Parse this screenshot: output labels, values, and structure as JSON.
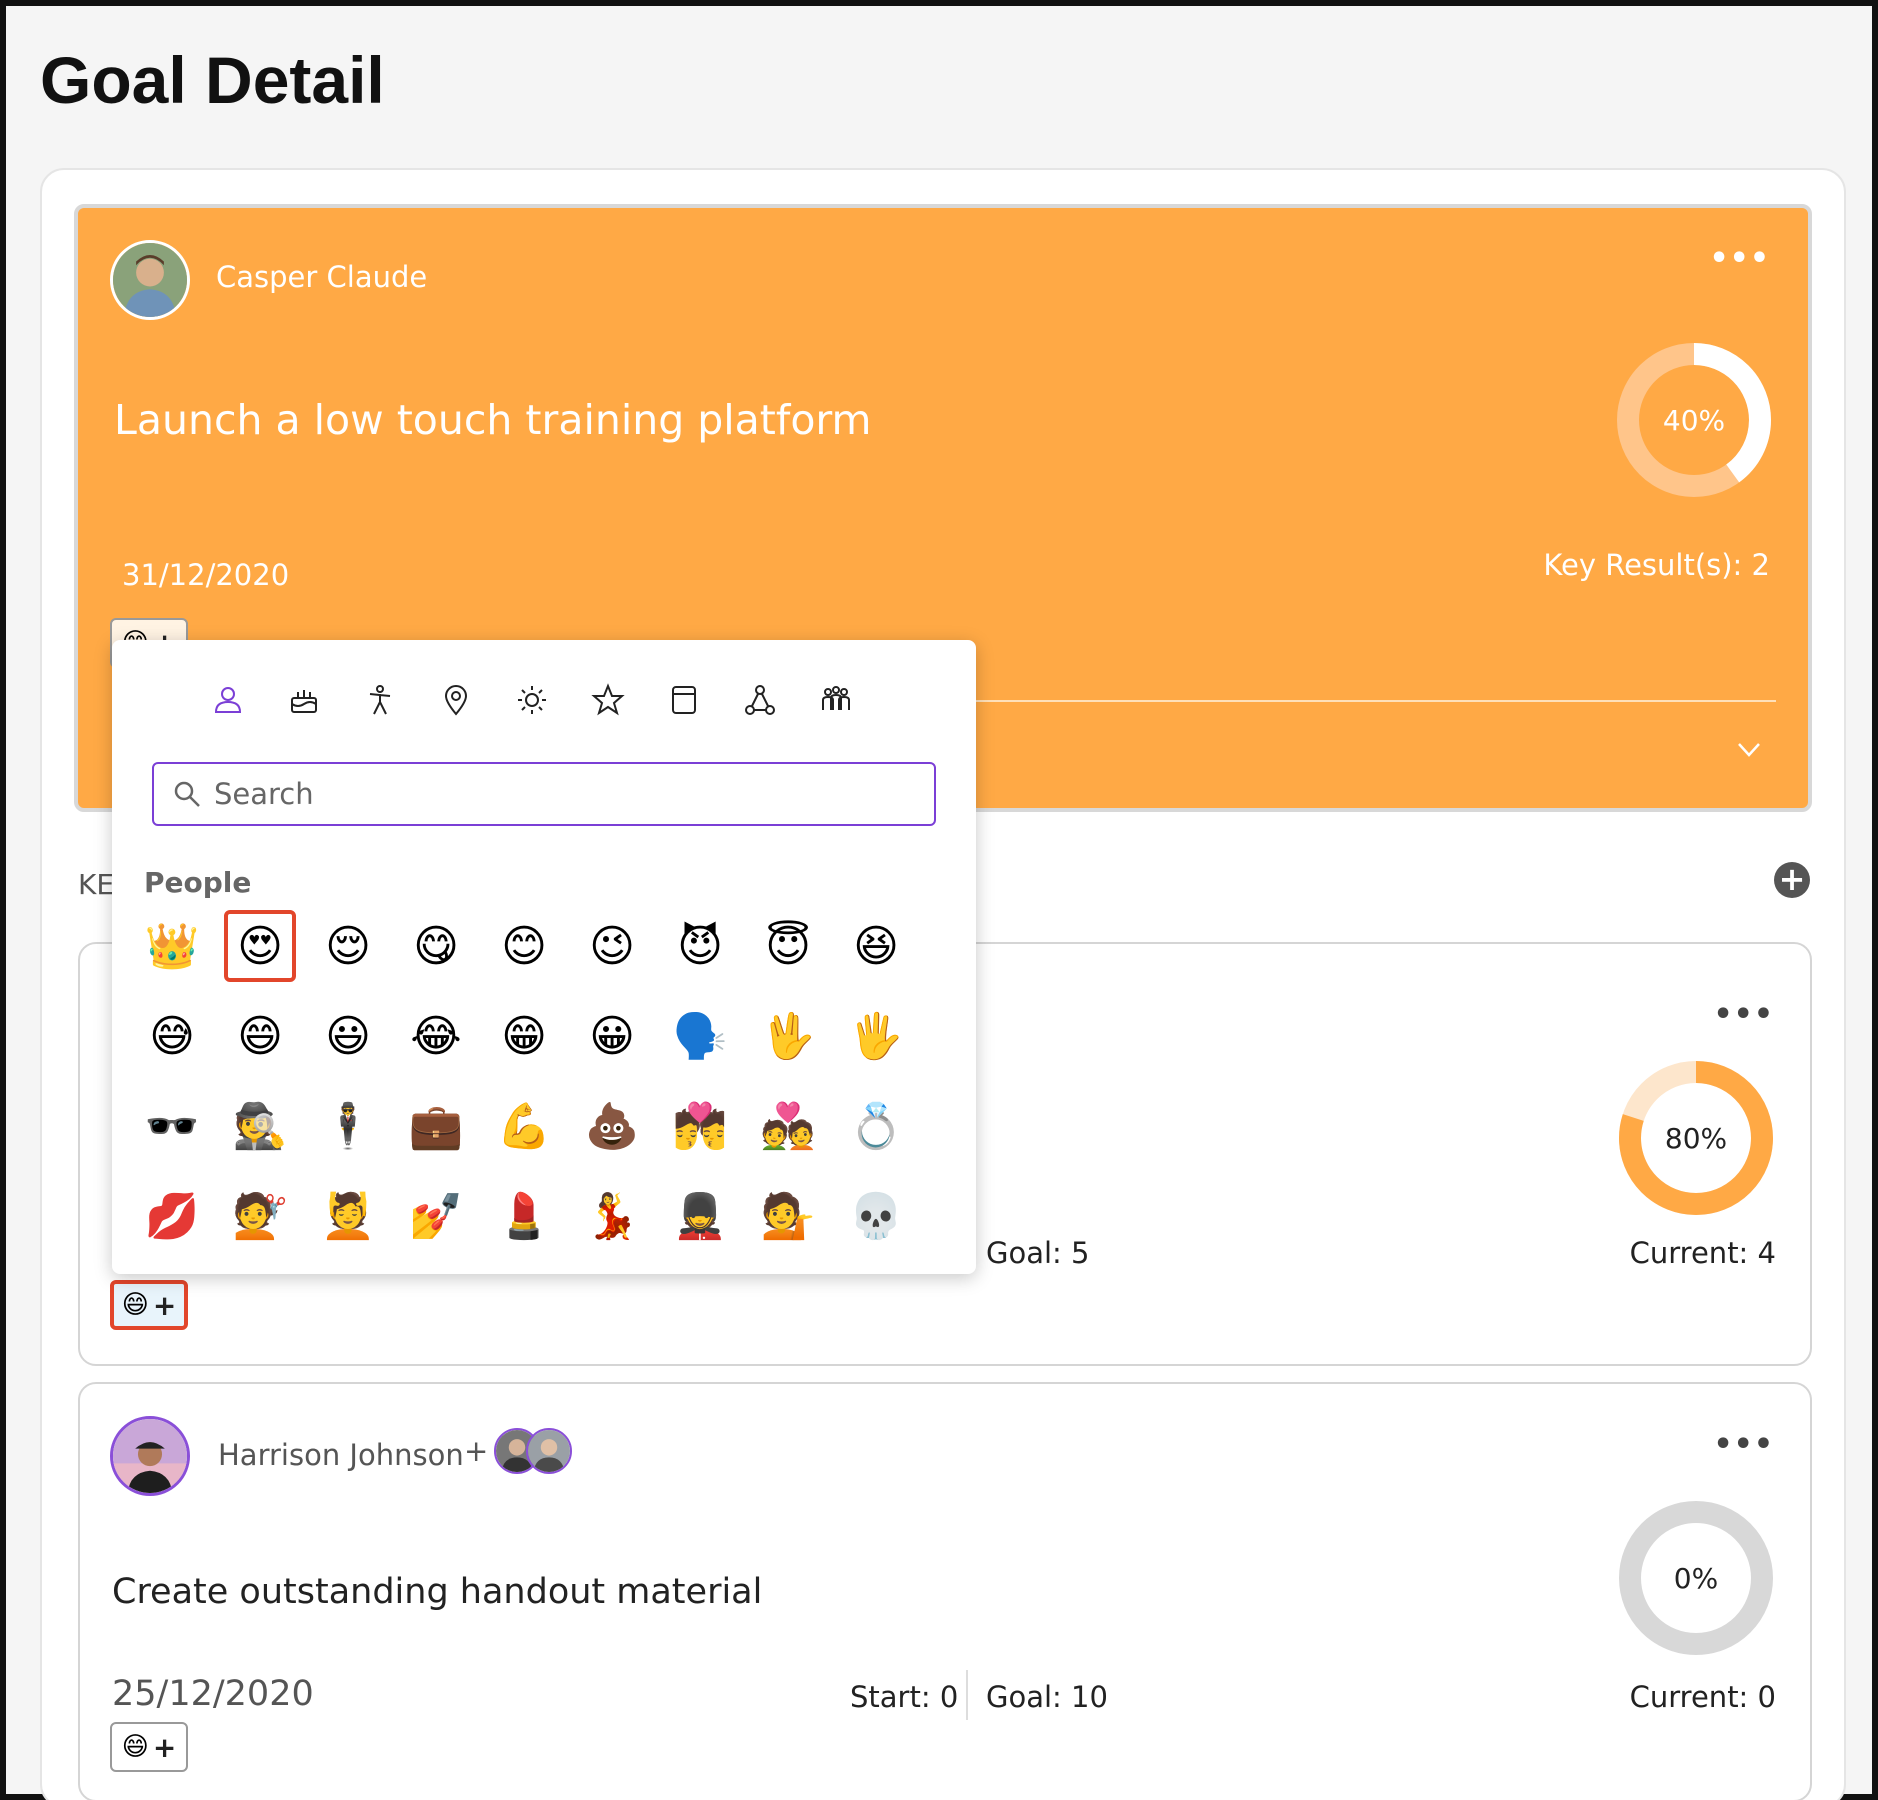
{
  "page": {
    "title": "Goal Detail"
  },
  "objective": {
    "owner": "Casper Claude",
    "title": "Launch a low touch training platform",
    "date": "31/12/2020",
    "key_results_label": "Key Result(s): 2",
    "progress_label": "40%",
    "progress": 0.4
  },
  "key_results_heading": "KE",
  "key_result_1": {
    "goal": "Goal: 5",
    "current": "Current: 4",
    "progress_label": "80%",
    "progress": 0.8
  },
  "key_result_2": {
    "owner": "Harrison Johnson",
    "plus": "+",
    "title": "Create outstanding handout material",
    "date": "25/12/2020",
    "start": "Start: 0",
    "goal": "Goal: 10",
    "current": "Current: 0",
    "progress_label": "0%",
    "progress": 0.0
  },
  "reaction_button": {
    "emoji": "😄",
    "plus": "+"
  },
  "emoji_picker": {
    "categories": [
      "people-icon",
      "food-icon",
      "activity-icon",
      "places-icon",
      "objects-icon",
      "symbols-icon",
      "flags-icon",
      "nature-icon",
      "custom-icon"
    ],
    "search_placeholder": "Search",
    "category_label": "People",
    "emojis": [
      "👑",
      "😍",
      "😌",
      "😋",
      "😊",
      "😉",
      "😈",
      "😇",
      "😆",
      "😅",
      "😄",
      "😃",
      "😂",
      "😁",
      "😀",
      "🗣️",
      "🖖",
      "🖐️",
      "🕶️",
      "🕵️",
      "🕴️",
      "💼",
      "💪",
      "💩",
      "💏",
      "💑",
      "💍",
      "💋",
      "💇",
      "💆",
      "💅",
      "💄",
      "💃",
      "💂",
      "💁",
      "💀"
    ],
    "selected_index": 1
  },
  "colors": {
    "accent": "#ffa945",
    "picker_accent": "#7b3fd6",
    "highlight": "#e2462b"
  }
}
